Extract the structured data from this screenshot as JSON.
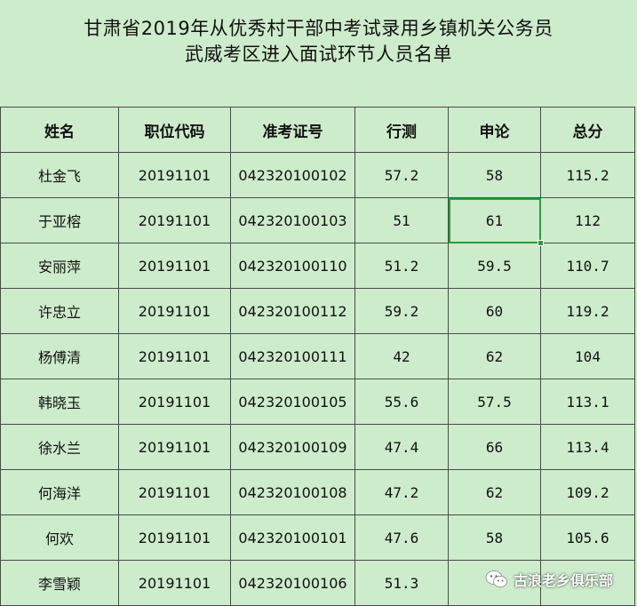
{
  "title": {
    "line1": "甘肃省2019年从优秀村干部中考试录用乡镇机关公务员",
    "line2": "武威考区进入面试环节人员名单"
  },
  "table": {
    "headers": [
      "姓名",
      "职位代码",
      "准考证号",
      "行测",
      "申论",
      "总分"
    ],
    "rows": [
      [
        "杜金飞",
        "20191101",
        "042320100102",
        "57.2",
        "58",
        "115.2"
      ],
      [
        "于亚榕",
        "20191101",
        "042320100103",
        "51",
        "61",
        "112"
      ],
      [
        "安丽萍",
        "20191101",
        "042320100110",
        "51.2",
        "59.5",
        "110.7"
      ],
      [
        "许忠立",
        "20191101",
        "042320100112",
        "59.2",
        "60",
        "119.2"
      ],
      [
        "杨傅清",
        "20191101",
        "042320100111",
        "42",
        "62",
        "104"
      ],
      [
        "韩晓玉",
        "20191101",
        "042320100105",
        "55.6",
        "57.5",
        "113.1"
      ],
      [
        "徐水兰",
        "20191101",
        "042320100109",
        "47.4",
        "66",
        "113.4"
      ],
      [
        "何海洋",
        "20191101",
        "042320100108",
        "47.2",
        "62",
        "109.2"
      ],
      [
        "何欢",
        "20191101",
        "042320100101",
        "47.6",
        "58",
        "105.6"
      ],
      [
        "李雪颖",
        "20191101",
        "042320100106",
        "51.3",
        "",
        ""
      ]
    ]
  },
  "watermark": {
    "text": "古浪老乡俱乐部",
    "icon": "wechat-icon"
  },
  "colors": {
    "background": "#cdeccb",
    "selection": "#2e9a3a",
    "border": "#4a4a4a"
  }
}
